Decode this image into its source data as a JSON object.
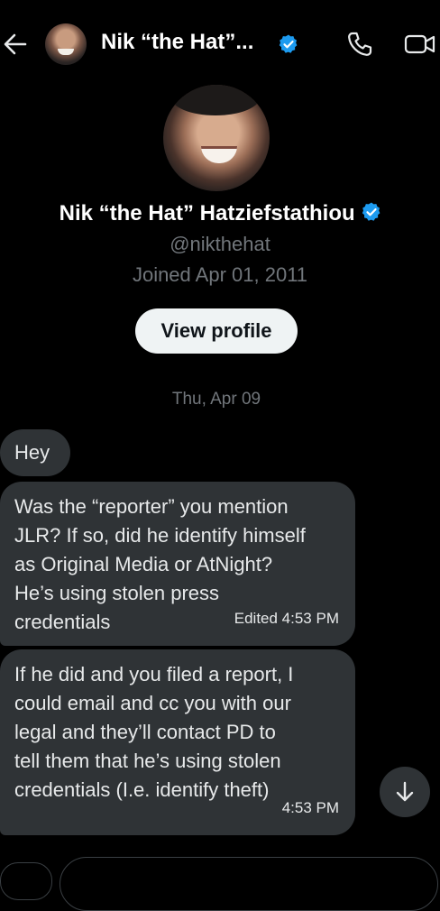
{
  "header": {
    "title": "Nik “the Hat”...",
    "back_icon": "arrow-left-icon",
    "call_icon": "phone-icon",
    "video_icon": "video-camera-icon",
    "verified_color": "#1d9bf0"
  },
  "profile": {
    "name": "Nik “the Hat” Hatziefstathiou",
    "handle": "@nikthehat",
    "joined": "Joined Apr 01, 2011",
    "view_profile_label": "View profile"
  },
  "conversation": {
    "date_separator": "Thu, Apr 09",
    "messages": [
      {
        "lines": [
          "Hey"
        ],
        "meta": ""
      },
      {
        "lines": [
          "Was the “reporter” you mention",
          "JLR? If so, did he identify himself",
          "as Original Media or AtNight?",
          "He’s using stolen press",
          "credentials"
        ],
        "meta": "Edited 4:53 PM"
      },
      {
        "lines": [
          "If he did and you filed a report, I",
          "could email and cc you with our",
          "legal and they’ll contact PD to",
          "tell them that he’s using stolen",
          "credentials (I.e. identify theft)"
        ],
        "meta": "4:53 PM"
      }
    ]
  },
  "colors": {
    "background": "#000000",
    "bubble": "#2f3336",
    "secondary_text": "#71767b",
    "button_bg": "#eff3f4"
  }
}
